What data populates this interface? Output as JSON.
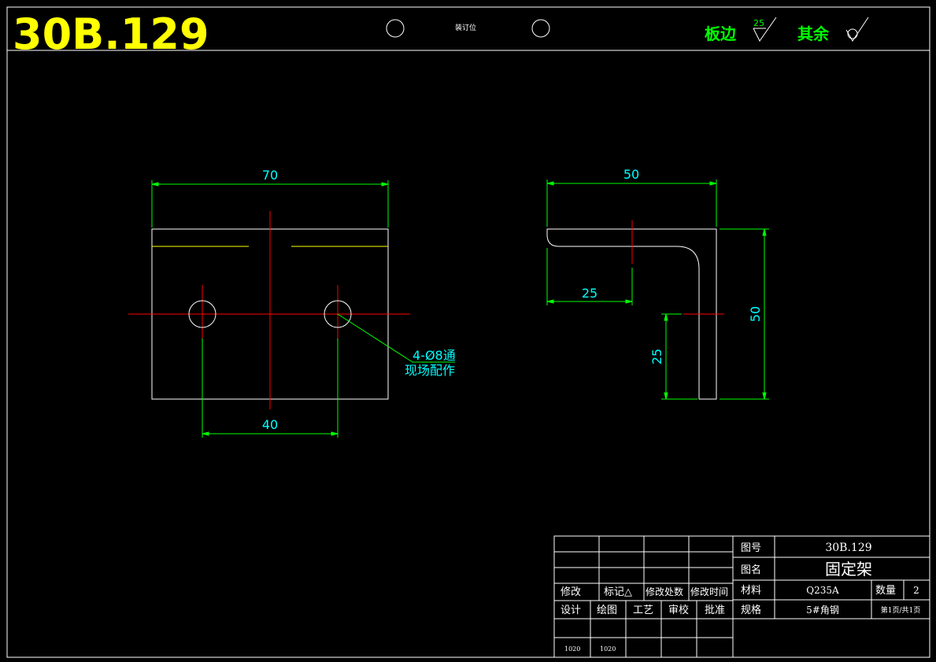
{
  "header": {
    "drawing_number_big": "30B.129",
    "binding_label": "装订位",
    "plate_edge_label": "板边",
    "plate_edge_roughness": "25",
    "other_label": "其余"
  },
  "colors": {
    "background": "#000000",
    "frame": "#ffffff",
    "dimension": "#00ff00",
    "dimension_text": "#00ffff",
    "centerline": "#ff0000",
    "title": "#ffff00",
    "header_green": "#00ff00"
  },
  "front_view": {
    "dim_width": "70",
    "dim_hole_spacing": "40",
    "hole_note_line1": "4-Ø8通",
    "hole_note_line2": "现场配作"
  },
  "side_view": {
    "dim_width": "50",
    "dim_height": "50",
    "dim_horizontal_offset": "25",
    "dim_vertical_offset": "25"
  },
  "title_block": {
    "revision_labels": [
      "修改",
      "标记△",
      "修改处数",
      "修改时间"
    ],
    "approval_labels": [
      "设计",
      "绘图",
      "工艺",
      "审校",
      "批准"
    ],
    "signature_values": [
      "1020",
      "1020"
    ],
    "drawing_no_label": "图号",
    "drawing_no_value": "30B.129",
    "drawing_name_label": "图名",
    "drawing_name_value": "固定架",
    "material_label": "材料",
    "material_value": "Q235A",
    "quantity_label": "数量",
    "quantity_value": "2",
    "spec_label": "规格",
    "spec_value": "5#角钢",
    "page_value": "第1页/共1页"
  }
}
